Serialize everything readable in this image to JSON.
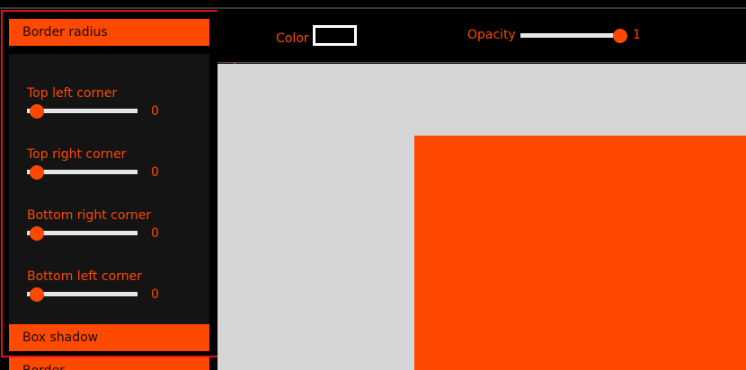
{
  "colors": {
    "accent": "#ff4800",
    "panel_background": "#141414",
    "canvas_background": "#d5d5d5",
    "highlight_outline": "#e3111b"
  },
  "sidebar": {
    "sections": {
      "border_radius": {
        "title": "Border radius",
        "controls": [
          {
            "label": "Top left corner",
            "value": "0"
          },
          {
            "label": "Top right corner",
            "value": "0"
          },
          {
            "label": "Bottom right corner",
            "value": "0"
          },
          {
            "label": "Bottom left corner",
            "value": "0"
          }
        ]
      },
      "box_shadow": {
        "title": "Box shadow"
      },
      "border": {
        "title": "Border"
      }
    }
  },
  "toolbar": {
    "color_label": "Color",
    "color_value": "#000000",
    "opacity_label": "Opacity",
    "opacity_value": "1"
  },
  "preview": {
    "fill_color": "#ff4800"
  }
}
